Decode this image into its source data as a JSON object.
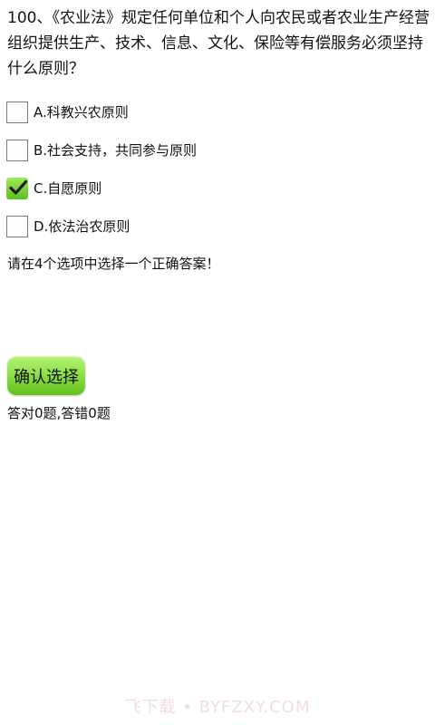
{
  "question": {
    "text": "100、《农业法》规定任何单位和个人向农民或者农业生产经营组织提供生产、技术、信息、文化、保险等有偿服务必须坚持什么原则？"
  },
  "options": [
    {
      "label": "A.科教兴农原则",
      "checked": false
    },
    {
      "label": "B.社会支持，共同参与原则",
      "checked": false
    },
    {
      "label": "C.自愿原则",
      "checked": true
    },
    {
      "label": "D.依法治农原则",
      "checked": false
    }
  ],
  "hint": "请在4个选项中选择一个正确答案！",
  "confirm_button": {
    "label": "确认选择"
  },
  "score": "答对0题,答错0题",
  "watermark": "飞下载 • BYFZXY.COM",
  "colors": {
    "button_green": "#8fe14a",
    "checkbox_checked_green": "#5fbf1e",
    "checkmark": "#1a1a1a"
  }
}
